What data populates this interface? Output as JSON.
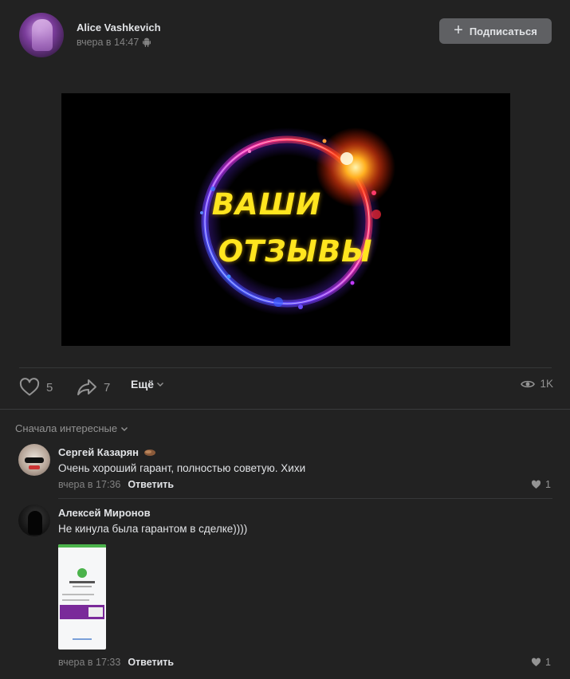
{
  "post": {
    "author": "Alice Vashkevich",
    "time": "вчера в 14:47",
    "platform_icon": "android-icon",
    "subscribe_label": "Подписаться",
    "image": {
      "line1": "ВАШИ",
      "line2": "ОТЗЫВЫ"
    },
    "likes": "5",
    "shares": "7",
    "more_label": "Ещё",
    "views": "1K"
  },
  "comments": {
    "sort_label": "Сначала интересные",
    "items": [
      {
        "author": "Сергей Казарян",
        "text": "Очень хороший гарант, полностью советую. Хихи",
        "time": "вчера в 17:36",
        "reply_label": "Ответить",
        "likes": "1"
      },
      {
        "author": "Алексей Миронов",
        "text": "Не кинула была гарантом в сделке))))",
        "time": "вчера в 17:33",
        "reply_label": "Ответить",
        "likes": "1"
      }
    ]
  },
  "colors": {
    "background": "#222222",
    "button": "#5f6063",
    "text": "#e1e3e6",
    "muted": "#828282",
    "image_text": "#ffe51f"
  }
}
